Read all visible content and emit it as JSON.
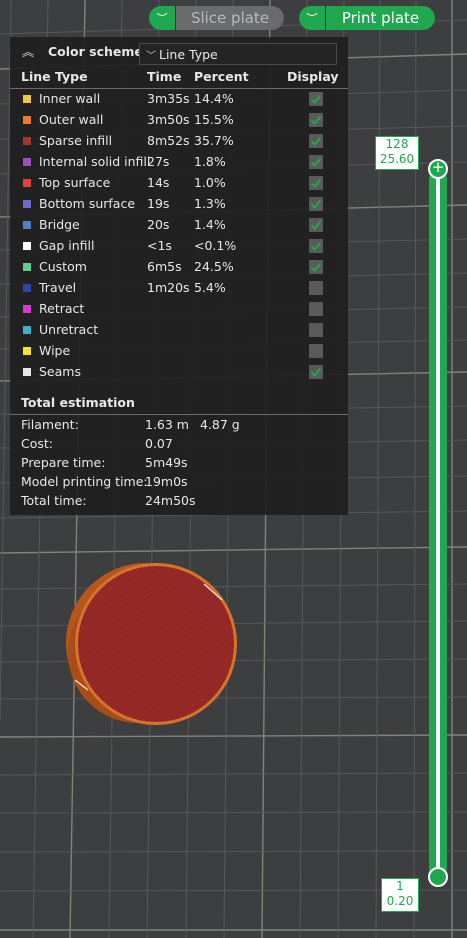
{
  "toolbar": {
    "slice_label": "Slice plate",
    "print_label": "Print plate",
    "accent": "#1fa84f"
  },
  "panel": {
    "title": "Color scheme",
    "scheme_value": "Line Type",
    "columns": {
      "type": "Line Type",
      "time": "Time",
      "percent": "Percent",
      "display": "Display"
    },
    "rows": [
      {
        "name": "Inner wall",
        "time": "3m35s",
        "percent": "14.4%",
        "color": "#f5c542",
        "display": true
      },
      {
        "name": "Outer wall",
        "time": "3m50s",
        "percent": "15.5%",
        "color": "#f07a2c",
        "display": true
      },
      {
        "name": "Sparse infill",
        "time": "8m52s",
        "percent": "35.7%",
        "color": "#a8322c",
        "display": true
      },
      {
        "name": "Internal solid infill",
        "time": "27s",
        "percent": "1.8%",
        "color": "#9b4fc4",
        "display": true
      },
      {
        "name": "Top surface",
        "time": "14s",
        "percent": "1.0%",
        "color": "#e8403a",
        "display": true
      },
      {
        "name": "Bottom surface",
        "time": "19s",
        "percent": "1.3%",
        "color": "#6f6acd",
        "display": true
      },
      {
        "name": "Bridge",
        "time": "20s",
        "percent": "1.4%",
        "color": "#4f82c2",
        "display": true
      },
      {
        "name": "Gap infill",
        "time": "<1s",
        "percent": "<0.1%",
        "color": "#ffffff",
        "display": true
      },
      {
        "name": "Custom",
        "time": "6m5s",
        "percent": "24.5%",
        "color": "#5fce8b",
        "display": true
      },
      {
        "name": "Travel",
        "time": "1m20s",
        "percent": "5.4%",
        "color": "#2f45a8",
        "display": false
      },
      {
        "name": "Retract",
        "time": "",
        "percent": "",
        "color": "#d63ad2",
        "display": false
      },
      {
        "name": "Unretract",
        "time": "",
        "percent": "",
        "color": "#3ab3c9",
        "display": false
      },
      {
        "name": "Wipe",
        "time": "",
        "percent": "",
        "color": "#f5e52c",
        "display": false
      },
      {
        "name": "Seams",
        "time": "",
        "percent": "",
        "color": "#e6e6e6",
        "display": true
      }
    ],
    "total_title": "Total estimation",
    "estimation": [
      {
        "label": "Filament:",
        "value": "1.63 m",
        "value2": "4.87 g"
      },
      {
        "label": "Cost:",
        "value": "0.07",
        "value2": ""
      },
      {
        "label": "Prepare time:",
        "value": "5m49s",
        "value2": ""
      },
      {
        "label": "Model printing time:",
        "value": "19m0s",
        "value2": ""
      },
      {
        "label": "Total time:",
        "value": "24m50s",
        "value2": ""
      }
    ]
  },
  "slider": {
    "top_layer": "128",
    "top_height": "25.60",
    "bottom_layer": "1",
    "bottom_height": "0.20"
  }
}
